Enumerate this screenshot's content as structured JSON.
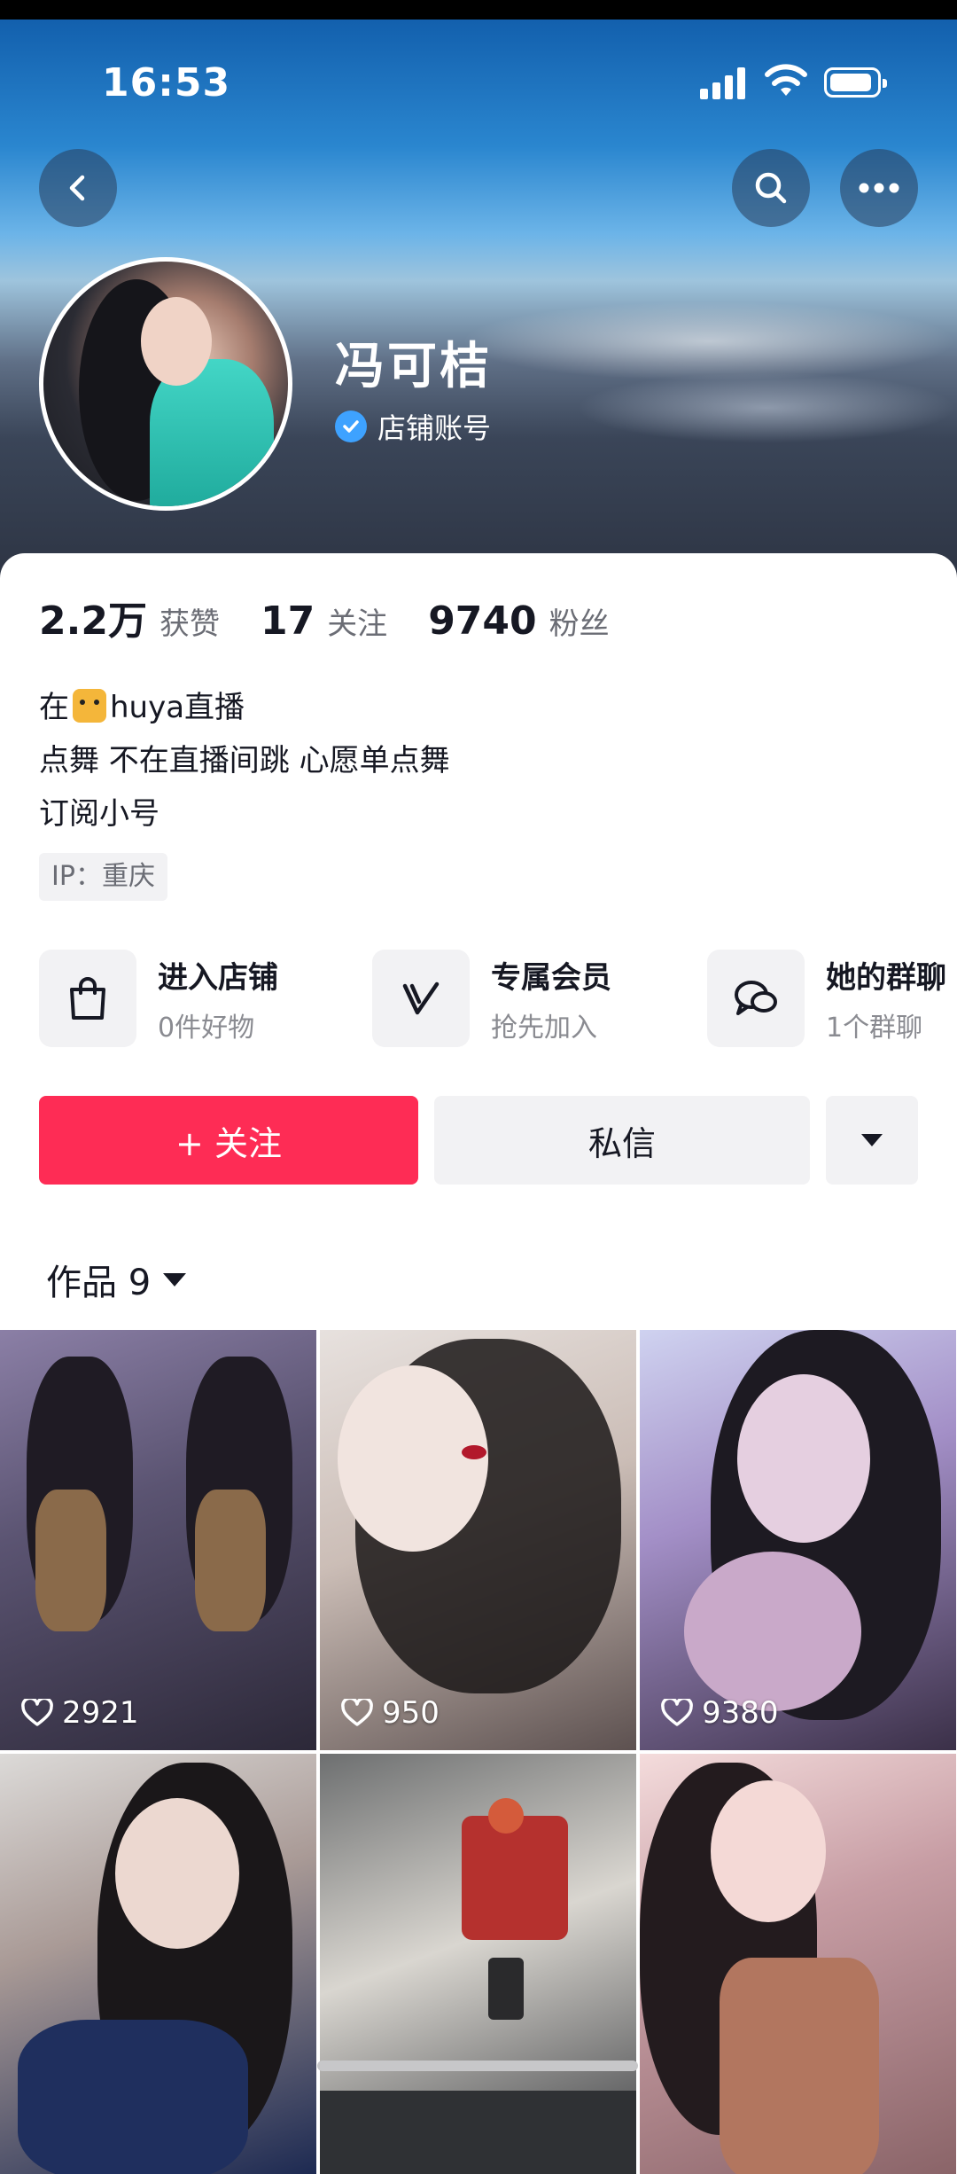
{
  "status_bar": {
    "time": "16:53"
  },
  "header": {
    "back_icon": "chevron-left-icon",
    "search_icon": "search-icon",
    "more_icon": "ellipsis-icon"
  },
  "profile": {
    "name": "冯可桔",
    "badge_label": "店铺账号",
    "badge_color": "#3ea2ff"
  },
  "stats": [
    {
      "value": "2.2万",
      "label": "获赞"
    },
    {
      "value": "17",
      "label": "关注"
    },
    {
      "value": "9740",
      "label": "粉丝"
    }
  ],
  "bio": {
    "line1_prefix": "在",
    "line1_suffix": "huya直播",
    "line2": "点舞 不在直播间跳  心愿单点舞",
    "line3": "订阅小号"
  },
  "ip_label": "IP：重庆",
  "features": [
    {
      "icon": "shopping-bag-icon",
      "title": "进入店铺",
      "subtitle": "0件好物"
    },
    {
      "icon": "v-member-icon",
      "title": "专属会员",
      "subtitle": "抢先加入"
    },
    {
      "icon": "group-chat-icon",
      "title": "她的群聊",
      "subtitle": "1个群聊"
    }
  ],
  "actions": {
    "follow": "+ 关注",
    "message": "私信",
    "accent_color": "#fe2c55"
  },
  "works": {
    "label": "作品 9"
  },
  "posts": [
    {
      "likes": "2921"
    },
    {
      "likes": "950"
    },
    {
      "likes": "9380"
    },
    {
      "likes": ""
    },
    {
      "likes": ""
    },
    {
      "likes": ""
    }
  ]
}
